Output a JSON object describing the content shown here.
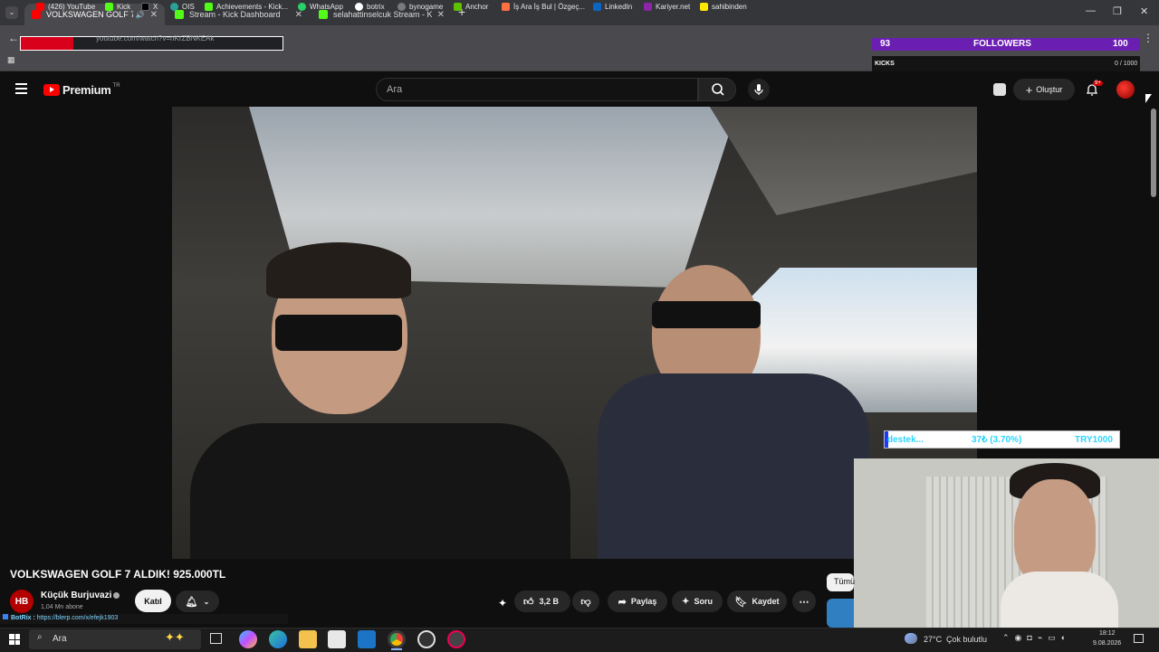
{
  "browser": {
    "tabs": [
      {
        "label": "VOLKSWAGEN GOLF 7 ALDI..."
      },
      {
        "label": "Stream - Kick Dashboard"
      },
      {
        "label": "selahattinselcuk Stream - Ki..."
      }
    ],
    "new_tab": "+",
    "address": "youtube.com/watch?v=nKrZBNKEAk",
    "bookmarks": [
      {
        "label": "(426) YouTube"
      },
      {
        "label": "Kick"
      },
      {
        "label": "X"
      },
      {
        "label": "OIS"
      },
      {
        "label": "Achievements - Kick..."
      },
      {
        "label": "WhatsApp"
      },
      {
        "label": "botrix"
      },
      {
        "label": "bynogame"
      },
      {
        "label": "Anchor"
      },
      {
        "label": "İş Ara İş Bul | Özgeç..."
      },
      {
        "label": "LinkedIn"
      },
      {
        "label": "Kariyer.net"
      },
      {
        "label": "sahibinden"
      }
    ]
  },
  "youtube": {
    "logo": "Premium",
    "logo_sup": "TR",
    "search_placeholder": "Ara",
    "create_label": "Oluştur",
    "notif_badge": "9+"
  },
  "overlay": {
    "followers_count": "93",
    "followers_label": "FOLLOWERS",
    "followers_goal": "100",
    "kicks_label": "KICKS",
    "kicks_progress": "0 / 1000",
    "donation_label": "destek...",
    "donation_pct": "37₺ (3.70%)",
    "donation_goal": "TRY1000"
  },
  "video": {
    "title": "VOLKSWAGEN GOLF 7 ALDIK! 925.000TL",
    "channel": "Küçük Burjuvazi",
    "subscribers": "1,04 Mn abone",
    "join_label": "Katıl",
    "likes": "3,2 B",
    "share_label": "Paylaş",
    "ask_label": "Soru",
    "save_label": "Kaydet",
    "chip_label": "Tümü"
  },
  "botrix": {
    "label": "BotRix :",
    "link": "https://blerp.com/x/efejk1903"
  },
  "taskbar": {
    "search_label": "Ara",
    "weather_temp": "27°C",
    "weather_text": "Çok bulutlu",
    "time": "18:12",
    "date": "9.08.2026"
  }
}
